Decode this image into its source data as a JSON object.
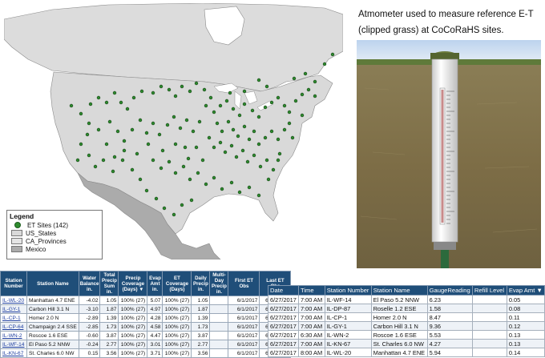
{
  "caption": "Atmometer used to measure reference E-T (clipped grass) at CoCoRaHS sites.",
  "colors": {
    "site": "#2e8b2e",
    "land": "#d9d9d9",
    "mexico": "#ababab",
    "header": "#1f4e79"
  },
  "legend": {
    "title": "Legend",
    "items": [
      {
        "label": "ET Sites (142)"
      },
      {
        "label": "US_States"
      },
      {
        "label": "CA_Provinces"
      },
      {
        "label": "Mexico"
      }
    ]
  },
  "station_table": {
    "headers": [
      "Station Number",
      "Station Name",
      "Water Balance in.",
      "Total Precip Sum in.",
      "Precip Coverage (Days) ▼",
      "Evap Amt in.",
      "ET Coverage (Days)",
      "Daily Precip in.",
      "Multi-Day Precip in.",
      "First ET Obs",
      "Last ET Obs"
    ],
    "rows": [
      [
        "IL-WL-20",
        "Manhattan 4.7 ENE",
        "-4.02",
        "1.05",
        "100% (27)",
        "5.07",
        "100% (27)",
        "1.05",
        "",
        "6/1/2017",
        "6/27/2017"
      ],
      [
        "IL-GY-1",
        "Carbon Hill 3.1 N",
        "-3.10",
        "1.87",
        "100% (27)",
        "4.97",
        "100% (27)",
        "1.87",
        "",
        "6/1/2017",
        "6/27/2017"
      ],
      [
        "IL-CP-1",
        "Homer 2.0 N",
        "-2.89",
        "1.39",
        "100% (27)",
        "4.28",
        "100% (27)",
        "1.39",
        "",
        "6/1/2017",
        "6/27/2017"
      ],
      [
        "IL-CP-64",
        "Champaign 2.4 SSE",
        "-2.85",
        "1.73",
        "100% (27)",
        "4.58",
        "100% (27)",
        "1.73",
        "",
        "6/1/2017",
        "6/27/2017"
      ],
      [
        "IL-WN-2",
        "Roscoe 1.6 ESE",
        "-0.60",
        "3.87",
        "100% (27)",
        "4.47",
        "100% (27)",
        "3.87",
        "",
        "6/1/2017",
        "6/27/2017"
      ],
      [
        "IL-WF-14",
        "El Paso 5.2 NNW",
        "-0.24",
        "2.77",
        "100% (27)",
        "3.01",
        "100% (27)",
        "2.77",
        "",
        "6/1/2017",
        "6/27/2017"
      ],
      [
        "IL-KN-67",
        "St. Charles 6.0 NW",
        "0.15",
        "3.56",
        "100% (27)",
        "3.71",
        "100% (27)",
        "3.56",
        "",
        "6/1/2017",
        "6/27/2017"
      ]
    ]
  },
  "obs_table": {
    "headers": [
      "Date",
      "Time",
      "Station Number",
      "Station Name",
      "GaugeReading",
      "Refill Level",
      "Evap Amt ▼"
    ],
    "rows": [
      [
        "6/27/2017",
        "7:00 AM",
        "IL-WF-14",
        "El Paso 5.2 NNW",
        "6.23",
        "",
        "0.05"
      ],
      [
        "6/27/2017",
        "7:00 AM",
        "IL-DP-87",
        "Roselle 1.2 ESE",
        "1.58",
        "",
        "0.08"
      ],
      [
        "6/27/2017",
        "7:00 AM",
        "IL-CP-1",
        "Homer 2.0 N",
        "8.47",
        "",
        "0.11"
      ],
      [
        "6/27/2017",
        "7:00 AM",
        "IL-GY-1",
        "Carbon Hill 3.1 N",
        "9.36",
        "",
        "0.12"
      ],
      [
        "6/27/2017",
        "6:30 AM",
        "IL-WN-2",
        "Roscoe 1.6 ESE",
        "5.53",
        "",
        "0.13"
      ],
      [
        "6/27/2017",
        "7:00 AM",
        "IL-KN-67",
        "St. Charles 6.0 NW",
        "4.27",
        "",
        "0.13"
      ],
      [
        "6/27/2017",
        "8:00 AM",
        "IL-WL-20",
        "Manhattan 4.7 ENE",
        "5.94",
        "",
        "0.14"
      ]
    ]
  }
}
